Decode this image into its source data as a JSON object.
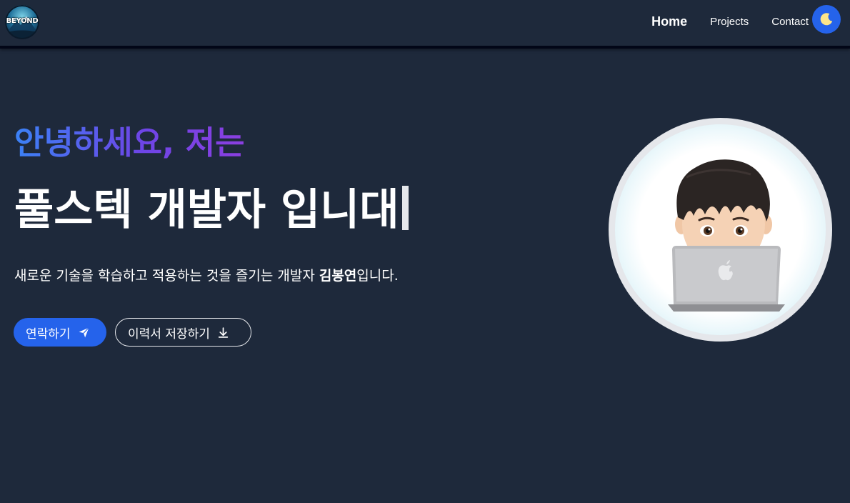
{
  "nav": {
    "logo_text": "BEYOND",
    "links": [
      {
        "label": "Home",
        "active": true
      },
      {
        "label": "Projects",
        "active": false
      },
      {
        "label": "Contact",
        "active": false
      }
    ],
    "theme_icon": "moon-icon"
  },
  "hero": {
    "greeting": "안녕하세요, 저는",
    "headline": "풀스텍 개발자 입니대",
    "intro_before": "새로운 기술을 학습하고 적용하는 것을 즐기는 개발자 ",
    "intro_name": "김봉연",
    "intro_after": "입니다.",
    "contact_button": {
      "label": "연락하기",
      "icon": "send-icon"
    },
    "resume_button": {
      "label": "이력서 저장하기",
      "icon": "download-icon"
    }
  },
  "colors": {
    "background": "#1e293b",
    "accent": "#2563eb",
    "gradient_start": "#3b82f6",
    "gradient_end": "#8b3fe0"
  },
  "avatar": {
    "icon": "memoji-laptop-avatar"
  }
}
